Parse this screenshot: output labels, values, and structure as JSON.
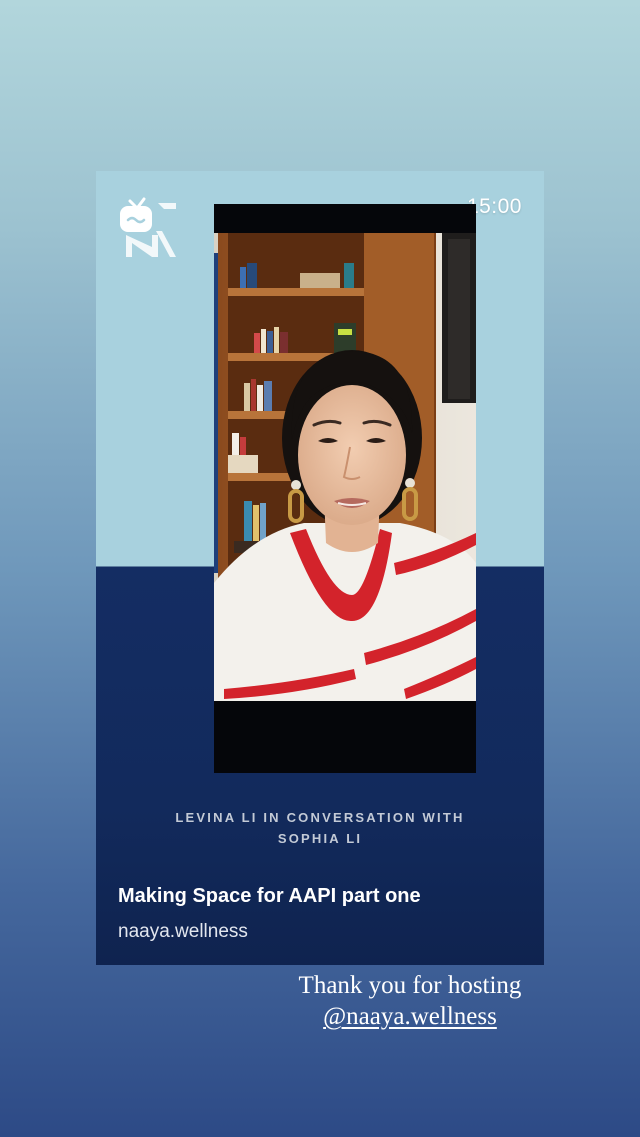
{
  "story": {
    "time": "15:00",
    "logo_icon": "igtv-n-logo-icon",
    "kicker_line1": "LEVINA LI IN CONVERSATION WITH",
    "kicker_line2": "SOPHIA LI",
    "title": "Making Space for AAPI part one",
    "handle": "naaya.wellness"
  },
  "overlay": {
    "thanks_line1": "Thank you for hosting",
    "mention": "@naaya.wellness"
  },
  "colors": {
    "card_top": "#a8d1de",
    "card_bottom": "#142d63",
    "accent_red": "#d3232b"
  }
}
